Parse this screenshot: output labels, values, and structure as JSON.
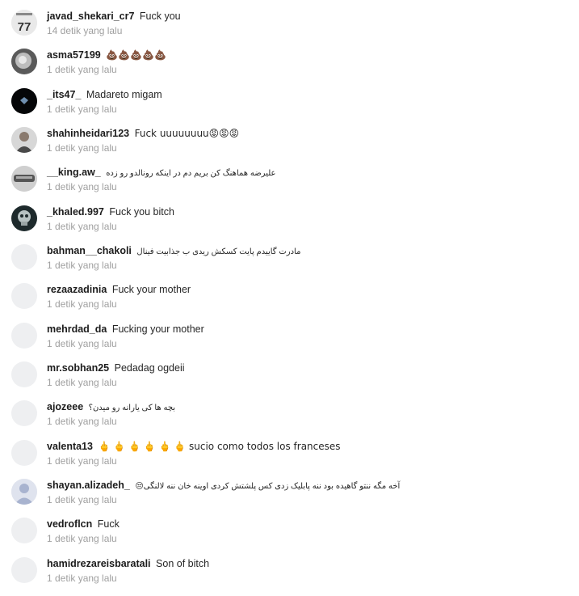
{
  "comments": [
    {
      "username": "javad_shekari_cr7",
      "text": "Fuck you",
      "time": "14 detik yang lalu",
      "avatar": "jersey-77",
      "avatar_label": "77",
      "rtl": false
    },
    {
      "username": "asma57199",
      "text": "💩💩💩💩💩",
      "time": "1 detik yang lalu",
      "avatar": "photo-dark",
      "rtl": false
    },
    {
      "username": "_its47_",
      "text": "Madareto migam",
      "time": "1 detik yang lalu",
      "avatar": "photo-black",
      "rtl": false
    },
    {
      "username": "shahinheidari123",
      "text": "Fuck uuuuuuuu😡😡😡",
      "time": "1 detik yang lalu",
      "avatar": "photo-person",
      "rtl": false
    },
    {
      "username": "__king.aw_",
      "text": "علیرضه هماهنگ کن بریم دم در اینکه رونالدو رو زده",
      "time": "1 detik yang lalu",
      "avatar": "photo-car",
      "rtl": true
    },
    {
      "username": "_khaled.997",
      "text": "Fuck you bitch",
      "time": "1 detik yang lalu",
      "avatar": "photo-skull",
      "rtl": false
    },
    {
      "username": "bahman__chakoli",
      "text": "مادرت گاییدم پایت کسکش ریدی ب جذابیت فینال",
      "time": "1 detik yang lalu",
      "avatar": "blank",
      "rtl": true
    },
    {
      "username": "rezaazadinia",
      "text": "Fuck your mother",
      "time": "1 detik yang lalu",
      "avatar": "blank",
      "rtl": false
    },
    {
      "username": "mehrdad_da",
      "text": "Fucking your mother",
      "time": "1 detik yang lalu",
      "avatar": "blank",
      "rtl": false
    },
    {
      "username": "mr.sobhan25",
      "text": "Pedadag ogdeii",
      "time": "1 detik yang lalu",
      "avatar": "blank",
      "rtl": false
    },
    {
      "username": "ajozeee",
      "text": "بچه ها کی یارانه رو میدن؟",
      "time": "1 detik yang lalu",
      "avatar": "blank",
      "rtl": true
    },
    {
      "username": "valenta13",
      "text": "🖕 🖕 🖕 🖕 🖕 🖕 sucio como todos los franceses",
      "time": "1 detik yang lalu",
      "avatar": "blank",
      "rtl": false
    },
    {
      "username": "shayan.alizadeh_",
      "text": "آخه مگه ننتو گاهیده بود ننه پابلیک زدی کس پلشتش کردی اوینه خان ننه لالنگی😒",
      "time": "1 detik yang lalu",
      "avatar": "default-person",
      "rtl": true
    },
    {
      "username": "vedroflcn",
      "text": "Fuck",
      "time": "1 detik yang lalu",
      "avatar": "blank",
      "rtl": false
    },
    {
      "username": "hamidrezareisbaratali",
      "text": "Son of bitch",
      "time": "1 detik yang lalu",
      "avatar": "blank",
      "rtl": false
    }
  ]
}
